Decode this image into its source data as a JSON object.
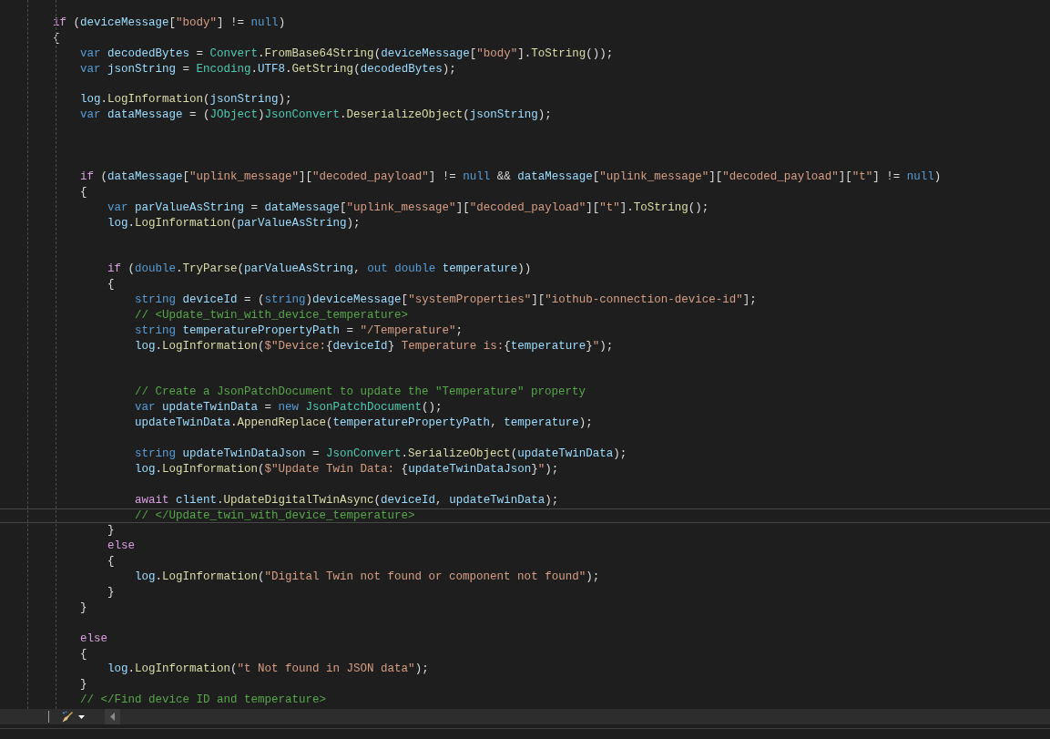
{
  "editor": {
    "lines": [
      {
        "current": false,
        "tokens": [
          {
            "kind": "control",
            "text": "    if"
          },
          {
            "kind": "punct",
            "text": " ("
          },
          {
            "kind": "identifier",
            "text": "deviceMessage"
          },
          {
            "kind": "punct",
            "text": "["
          },
          {
            "kind": "string",
            "text": "\"body\""
          },
          {
            "kind": "punct",
            "text": "] != "
          },
          {
            "kind": "keyword",
            "text": "null"
          },
          {
            "kind": "punct",
            "text": ")"
          }
        ]
      },
      {
        "current": false,
        "tokens": [
          {
            "kind": "punct",
            "text": "    {"
          }
        ]
      },
      {
        "current": false,
        "tokens": [
          {
            "kind": "keyword",
            "text": "        var"
          },
          {
            "kind": "identifier",
            "text": " decodedBytes"
          },
          {
            "kind": "punct",
            "text": " = "
          },
          {
            "kind": "type",
            "text": "Convert"
          },
          {
            "kind": "punct",
            "text": "."
          },
          {
            "kind": "method",
            "text": "FromBase64String"
          },
          {
            "kind": "punct",
            "text": "("
          },
          {
            "kind": "identifier",
            "text": "deviceMessage"
          },
          {
            "kind": "punct",
            "text": "["
          },
          {
            "kind": "string",
            "text": "\"body\""
          },
          {
            "kind": "punct",
            "text": "]."
          },
          {
            "kind": "method",
            "text": "ToString"
          },
          {
            "kind": "punct",
            "text": "());"
          }
        ]
      },
      {
        "current": false,
        "tokens": [
          {
            "kind": "keyword",
            "text": "        var"
          },
          {
            "kind": "identifier",
            "text": " jsonString"
          },
          {
            "kind": "punct",
            "text": " = "
          },
          {
            "kind": "type",
            "text": "Encoding"
          },
          {
            "kind": "punct",
            "text": "."
          },
          {
            "kind": "identifier",
            "text": "UTF8"
          },
          {
            "kind": "punct",
            "text": "."
          },
          {
            "kind": "method",
            "text": "GetString"
          },
          {
            "kind": "punct",
            "text": "("
          },
          {
            "kind": "identifier",
            "text": "decodedBytes"
          },
          {
            "kind": "punct",
            "text": ");"
          }
        ]
      },
      {
        "current": false
      },
      {
        "current": false,
        "tokens": [
          {
            "kind": "identifier",
            "text": "        log"
          },
          {
            "kind": "punct",
            "text": "."
          },
          {
            "kind": "method",
            "text": "LogInformation"
          },
          {
            "kind": "punct",
            "text": "("
          },
          {
            "kind": "identifier",
            "text": "jsonString"
          },
          {
            "kind": "punct",
            "text": ");"
          }
        ]
      },
      {
        "current": false,
        "tokens": [
          {
            "kind": "keyword",
            "text": "        var"
          },
          {
            "kind": "identifier",
            "text": " dataMessage"
          },
          {
            "kind": "punct",
            "text": " = ("
          },
          {
            "kind": "type",
            "text": "JObject"
          },
          {
            "kind": "punct",
            "text": ")"
          },
          {
            "kind": "type",
            "text": "JsonConvert"
          },
          {
            "kind": "punct",
            "text": "."
          },
          {
            "kind": "method",
            "text": "DeserializeObject"
          },
          {
            "kind": "punct",
            "text": "("
          },
          {
            "kind": "identifier",
            "text": "jsonString"
          },
          {
            "kind": "punct",
            "text": ");"
          }
        ]
      },
      {
        "current": false
      },
      {
        "current": false
      },
      {
        "current": false
      },
      {
        "current": false,
        "tokens": [
          {
            "kind": "control",
            "text": "        if"
          },
          {
            "kind": "punct",
            "text": " ("
          },
          {
            "kind": "identifier",
            "text": "dataMessage"
          },
          {
            "kind": "punct",
            "text": "["
          },
          {
            "kind": "string",
            "text": "\"uplink_message\""
          },
          {
            "kind": "punct",
            "text": "]["
          },
          {
            "kind": "string",
            "text": "\"decoded_payload\""
          },
          {
            "kind": "punct",
            "text": "] != "
          },
          {
            "kind": "keyword",
            "text": "null"
          },
          {
            "kind": "punct",
            "text": " && "
          },
          {
            "kind": "identifier",
            "text": "dataMessage"
          },
          {
            "kind": "punct",
            "text": "["
          },
          {
            "kind": "string",
            "text": "\"uplink_message\""
          },
          {
            "kind": "punct",
            "text": "]["
          },
          {
            "kind": "string",
            "text": "\"decoded_payload\""
          },
          {
            "kind": "punct",
            "text": "]["
          },
          {
            "kind": "string",
            "text": "\"t\""
          },
          {
            "kind": "punct",
            "text": "] != "
          },
          {
            "kind": "keyword",
            "text": "null"
          },
          {
            "kind": "punct",
            "text": ")"
          }
        ]
      },
      {
        "current": false,
        "tokens": [
          {
            "kind": "punct",
            "text": "        {"
          }
        ]
      },
      {
        "current": false,
        "tokens": [
          {
            "kind": "keyword",
            "text": "            var"
          },
          {
            "kind": "identifier",
            "text": " parValueAsString"
          },
          {
            "kind": "punct",
            "text": " = "
          },
          {
            "kind": "identifier",
            "text": "dataMessage"
          },
          {
            "kind": "punct",
            "text": "["
          },
          {
            "kind": "string",
            "text": "\"uplink_message\""
          },
          {
            "kind": "punct",
            "text": "]["
          },
          {
            "kind": "string",
            "text": "\"decoded_payload\""
          },
          {
            "kind": "punct",
            "text": "]["
          },
          {
            "kind": "string",
            "text": "\"t\""
          },
          {
            "kind": "punct",
            "text": "]."
          },
          {
            "kind": "method",
            "text": "ToString"
          },
          {
            "kind": "punct",
            "text": "();"
          }
        ]
      },
      {
        "current": false,
        "tokens": [
          {
            "kind": "identifier",
            "text": "            log"
          },
          {
            "kind": "punct",
            "text": "."
          },
          {
            "kind": "method",
            "text": "LogInformation"
          },
          {
            "kind": "punct",
            "text": "("
          },
          {
            "kind": "identifier",
            "text": "parValueAsString"
          },
          {
            "kind": "punct",
            "text": ");"
          }
        ]
      },
      {
        "current": false
      },
      {
        "current": false
      },
      {
        "current": false,
        "tokens": [
          {
            "kind": "control",
            "text": "            if"
          },
          {
            "kind": "punct",
            "text": " ("
          },
          {
            "kind": "keyword",
            "text": "double"
          },
          {
            "kind": "punct",
            "text": "."
          },
          {
            "kind": "method",
            "text": "TryParse"
          },
          {
            "kind": "punct",
            "text": "("
          },
          {
            "kind": "identifier",
            "text": "parValueAsString"
          },
          {
            "kind": "punct",
            "text": ", "
          },
          {
            "kind": "keyword",
            "text": "out"
          },
          {
            "kind": "keyword",
            "text": " double"
          },
          {
            "kind": "identifier",
            "text": " temperature"
          },
          {
            "kind": "punct",
            "text": "))"
          }
        ]
      },
      {
        "current": false,
        "tokens": [
          {
            "kind": "punct",
            "text": "            {"
          }
        ]
      },
      {
        "current": false,
        "tokens": [
          {
            "kind": "keyword",
            "text": "                string"
          },
          {
            "kind": "identifier",
            "text": " deviceId"
          },
          {
            "kind": "punct",
            "text": " = ("
          },
          {
            "kind": "keyword",
            "text": "string"
          },
          {
            "kind": "punct",
            "text": ")"
          },
          {
            "kind": "identifier",
            "text": "deviceMessage"
          },
          {
            "kind": "punct",
            "text": "["
          },
          {
            "kind": "string",
            "text": "\"systemProperties\""
          },
          {
            "kind": "punct",
            "text": "]["
          },
          {
            "kind": "string",
            "text": "\"iothub-connection-device-id\""
          },
          {
            "kind": "punct",
            "text": "];"
          }
        ]
      },
      {
        "current": false,
        "tokens": [
          {
            "kind": "comment",
            "text": "                // <Update_twin_with_device_temperature>"
          }
        ]
      },
      {
        "current": false,
        "tokens": [
          {
            "kind": "keyword",
            "text": "                string"
          },
          {
            "kind": "identifier",
            "text": " temperaturePropertyPath"
          },
          {
            "kind": "punct",
            "text": " = "
          },
          {
            "kind": "string",
            "text": "\"/Temperature\""
          },
          {
            "kind": "punct",
            "text": ";"
          }
        ]
      },
      {
        "current": false,
        "tokens": [
          {
            "kind": "identifier",
            "text": "                log"
          },
          {
            "kind": "punct",
            "text": "."
          },
          {
            "kind": "method",
            "text": "LogInformation"
          },
          {
            "kind": "punct",
            "text": "("
          },
          {
            "kind": "string",
            "text": "$\"Device:"
          },
          {
            "kind": "punct",
            "text": "{"
          },
          {
            "kind": "identifier",
            "text": "deviceId"
          },
          {
            "kind": "punct",
            "text": "}"
          },
          {
            "kind": "string",
            "text": " Temperature is:"
          },
          {
            "kind": "punct",
            "text": "{"
          },
          {
            "kind": "identifier",
            "text": "temperature"
          },
          {
            "kind": "punct",
            "text": "}"
          },
          {
            "kind": "string",
            "text": "\""
          },
          {
            "kind": "punct",
            "text": ");"
          }
        ]
      },
      {
        "current": false
      },
      {
        "current": false
      },
      {
        "current": false,
        "tokens": [
          {
            "kind": "comment",
            "text": "                // Create a JsonPatchDocument to update the \"Temperature\" property"
          }
        ]
      },
      {
        "current": false,
        "tokens": [
          {
            "kind": "keyword",
            "text": "                var"
          },
          {
            "kind": "identifier",
            "text": " updateTwinData"
          },
          {
            "kind": "punct",
            "text": " = "
          },
          {
            "kind": "keyword",
            "text": "new"
          },
          {
            "kind": "type",
            "text": " JsonPatchDocument"
          },
          {
            "kind": "punct",
            "text": "();"
          }
        ]
      },
      {
        "current": false,
        "tokens": [
          {
            "kind": "identifier",
            "text": "                updateTwinData"
          },
          {
            "kind": "punct",
            "text": "."
          },
          {
            "kind": "method",
            "text": "AppendReplace"
          },
          {
            "kind": "punct",
            "text": "("
          },
          {
            "kind": "identifier",
            "text": "temperaturePropertyPath"
          },
          {
            "kind": "punct",
            "text": ", "
          },
          {
            "kind": "identifier",
            "text": "temperature"
          },
          {
            "kind": "punct",
            "text": ");"
          }
        ]
      },
      {
        "current": false
      },
      {
        "current": false,
        "tokens": [
          {
            "kind": "keyword",
            "text": "                string"
          },
          {
            "kind": "identifier",
            "text": " updateTwinDataJson"
          },
          {
            "kind": "punct",
            "text": " = "
          },
          {
            "kind": "type",
            "text": "JsonConvert"
          },
          {
            "kind": "punct",
            "text": "."
          },
          {
            "kind": "method",
            "text": "SerializeObject"
          },
          {
            "kind": "punct",
            "text": "("
          },
          {
            "kind": "identifier",
            "text": "updateTwinData"
          },
          {
            "kind": "punct",
            "text": ");"
          }
        ]
      },
      {
        "current": false,
        "tokens": [
          {
            "kind": "identifier",
            "text": "                log"
          },
          {
            "kind": "punct",
            "text": "."
          },
          {
            "kind": "method",
            "text": "LogInformation"
          },
          {
            "kind": "punct",
            "text": "("
          },
          {
            "kind": "string",
            "text": "$\"Update Twin Data: "
          },
          {
            "kind": "punct",
            "text": "{"
          },
          {
            "kind": "identifier",
            "text": "updateTwinDataJson"
          },
          {
            "kind": "punct",
            "text": "}"
          },
          {
            "kind": "string",
            "text": "\""
          },
          {
            "kind": "punct",
            "text": ");"
          }
        ]
      },
      {
        "current": false
      },
      {
        "current": false,
        "tokens": [
          {
            "kind": "control",
            "text": "                await"
          },
          {
            "kind": "identifier",
            "text": " client"
          },
          {
            "kind": "punct",
            "text": "."
          },
          {
            "kind": "method",
            "text": "UpdateDigitalTwinAsync"
          },
          {
            "kind": "punct",
            "text": "("
          },
          {
            "kind": "identifier",
            "text": "deviceId"
          },
          {
            "kind": "punct",
            "text": ", "
          },
          {
            "kind": "identifier",
            "text": "updateTwinData"
          },
          {
            "kind": "punct",
            "text": ");"
          }
        ]
      },
      {
        "current": true,
        "tokens": [
          {
            "kind": "comment",
            "text": "                // </Update_twin_with_device_temperature>"
          }
        ]
      },
      {
        "current": false,
        "tokens": [
          {
            "kind": "punct",
            "text": "            }"
          }
        ]
      },
      {
        "current": false,
        "tokens": [
          {
            "kind": "control",
            "text": "            else"
          }
        ]
      },
      {
        "current": false,
        "tokens": [
          {
            "kind": "punct",
            "text": "            {"
          }
        ]
      },
      {
        "current": false,
        "tokens": [
          {
            "kind": "identifier",
            "text": "                log"
          },
          {
            "kind": "punct",
            "text": "."
          },
          {
            "kind": "method",
            "text": "LogInformation"
          },
          {
            "kind": "punct",
            "text": "("
          },
          {
            "kind": "string",
            "text": "\"Digital Twin not found or component not found\""
          },
          {
            "kind": "punct",
            "text": ");"
          }
        ]
      },
      {
        "current": false,
        "tokens": [
          {
            "kind": "punct",
            "text": "            }"
          }
        ]
      },
      {
        "current": false,
        "tokens": [
          {
            "kind": "punct",
            "text": "        }"
          }
        ]
      },
      {
        "current": false
      },
      {
        "current": false,
        "tokens": [
          {
            "kind": "control",
            "text": "        else"
          }
        ]
      },
      {
        "current": false,
        "tokens": [
          {
            "kind": "punct",
            "text": "        {"
          }
        ]
      },
      {
        "current": false,
        "tokens": [
          {
            "kind": "identifier",
            "text": "            log"
          },
          {
            "kind": "punct",
            "text": "."
          },
          {
            "kind": "method",
            "text": "LogInformation"
          },
          {
            "kind": "punct",
            "text": "("
          },
          {
            "kind": "string",
            "text": "\"t Not found in JSON data\""
          },
          {
            "kind": "punct",
            "text": ");"
          }
        ]
      },
      {
        "current": false,
        "tokens": [
          {
            "kind": "punct",
            "text": "        }"
          }
        ]
      },
      {
        "current": false,
        "tokens": [
          {
            "kind": "comment",
            "text": "        // </Find device ID and temperature>"
          }
        ]
      }
    ]
  }
}
